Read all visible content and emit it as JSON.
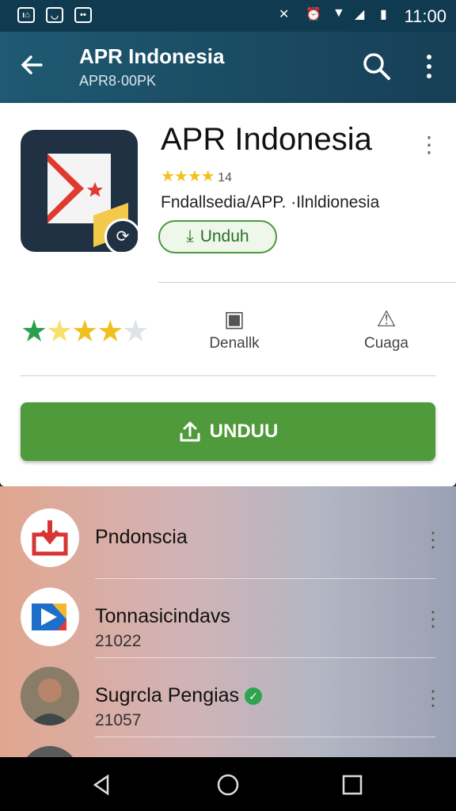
{
  "status": {
    "time": "11:00",
    "left_icons": [
      "image-icon",
      "smile-icon",
      "dots-icon"
    ]
  },
  "app_bar": {
    "title": "APR Indonesia",
    "subtitle": "APR8·00PK"
  },
  "detail": {
    "title": "APR Indonesia",
    "rating_count": "14",
    "developer": "Fndallsedia/APP. ·Ilnldionesia",
    "install_label": "Unduh",
    "stats": [
      {
        "icon": "ay-badge-icon",
        "label": "Denallk"
      },
      {
        "icon": "triangle-plus-icon",
        "label": "Cuaga"
      }
    ],
    "big_button_label": "UNDUU",
    "rating_value": 4
  },
  "list": [
    {
      "title": "Pndonscia",
      "subtitle": ""
    },
    {
      "title": "Tonnasicindavs",
      "subtitle": "21022"
    },
    {
      "title": "Sugrcla Pengias",
      "subtitle": "21057"
    }
  ]
}
